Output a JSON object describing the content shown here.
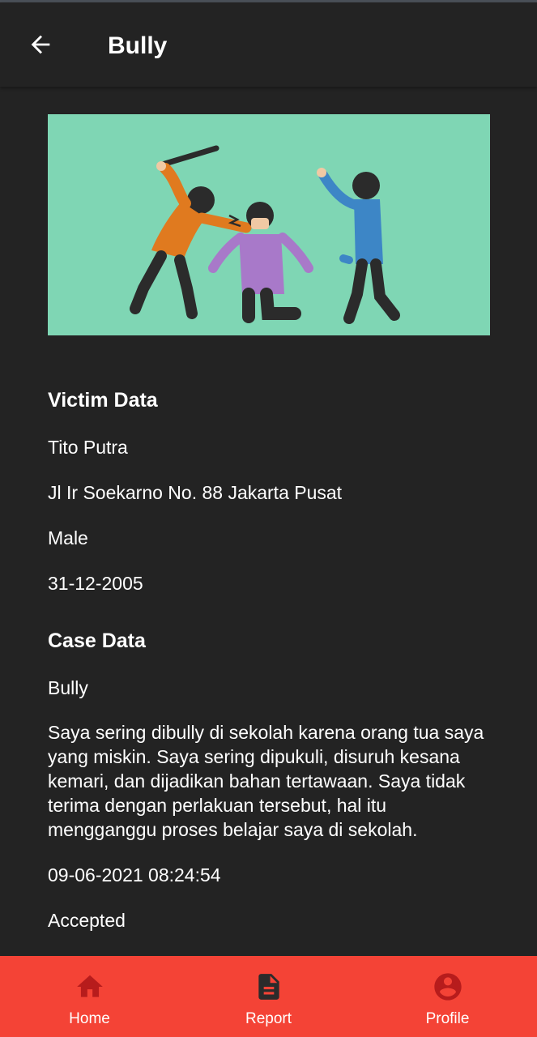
{
  "appbar": {
    "title": "Bully",
    "back_icon": "arrow-back-icon"
  },
  "victim": {
    "heading": "Victim Data",
    "name": "Tito Putra",
    "address": "Jl Ir Soekarno No. 88 Jakarta Pusat",
    "gender": "Male",
    "birth_date": "31-12-2005"
  },
  "case": {
    "heading": "Case Data",
    "type": "Bully",
    "description": "Saya sering dibully di sekolah karena orang tua saya yang miskin. Saya sering dipukuli, disuruh kesana kemari, dan dijadikan bahan tertawaan. Saya tidak terima dengan perlakuan tersebut, hal itu mengganggu proses belajar saya di sekolah.",
    "datetime": "09-06-2021 08:24:54",
    "status": "Accepted"
  },
  "bottom_nav": {
    "items": [
      {
        "label": "Home",
        "icon": "home-icon"
      },
      {
        "label": "Report",
        "icon": "report-document-icon"
      },
      {
        "label": "Profile",
        "icon": "profile-account-icon"
      }
    ]
  },
  "colors": {
    "background": "#232323",
    "accent": "#f44336",
    "icon_active": "#b71c1c",
    "hero_background": "#7fd6b4"
  }
}
